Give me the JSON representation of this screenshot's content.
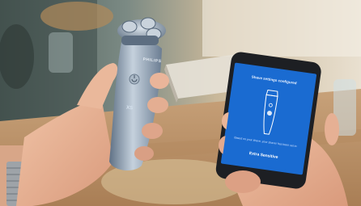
{
  "photo": {
    "subject": "Hands holding an electric shaver and a smartphone showing shaver settings app",
    "shaver": {
      "brand": "PHILIPS",
      "model": "XS"
    },
    "phone_screen": {
      "title": "Shave settings configured",
      "message": "Based on your shave, your shaver has been set to",
      "setting": "Extra Sensitive"
    },
    "colors": {
      "app_blue": "#1a6bd1",
      "shaver_body": "#8a9bb0",
      "skin": "#e9b396"
    }
  }
}
